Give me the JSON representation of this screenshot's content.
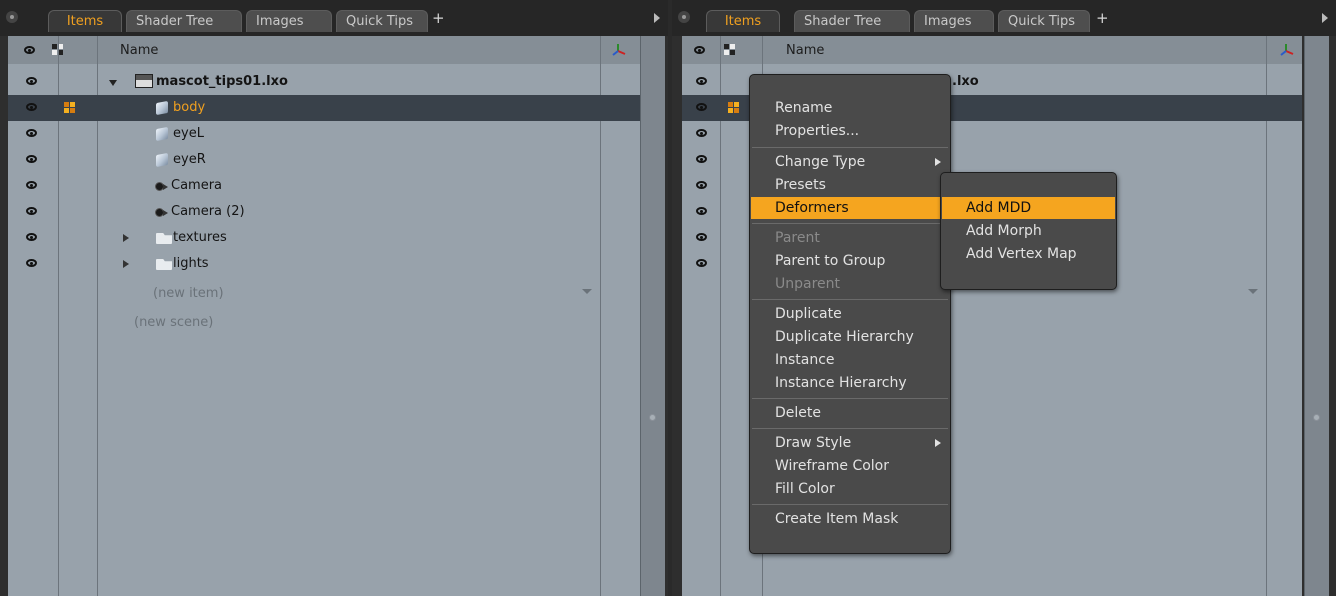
{
  "colors": {
    "accent": "#f0a020",
    "highlight": "#f5a51f",
    "list_bg": "#98a2ab",
    "selected_row": "#39414a",
    "menu_bg": "#4a4a4a"
  },
  "left_panel": {
    "tabs": [
      "Items",
      "Shader Tree",
      "Images",
      "Quick Tips"
    ],
    "add_tab": "+",
    "header_name": "Name",
    "scene_name": "mascot_tips01.lxo",
    "items": [
      {
        "label": "body",
        "icon": "mesh-icon",
        "selected": true
      },
      {
        "label": "eyeL",
        "icon": "mesh-icon"
      },
      {
        "label": "eyeR",
        "icon": "mesh-icon"
      },
      {
        "label": "Camera",
        "icon": "camera-icon"
      },
      {
        "label": "Camera (2)",
        "icon": "camera-icon"
      },
      {
        "label": "textures",
        "icon": "folder-icon",
        "collapsed": true
      },
      {
        "label": "lights",
        "icon": "folder-icon",
        "collapsed": true
      }
    ],
    "new_item": "(new item)",
    "new_scene": "(new scene)"
  },
  "right_panel": {
    "tabs": [
      "Items",
      "Shader Tree",
      "Images",
      "Quick Tips"
    ],
    "add_tab": "+",
    "header_name": "Name",
    "scene_name_visible": ".lxo"
  },
  "context_menu": {
    "groups": [
      [
        {
          "label": "Rename"
        },
        {
          "label": "Properties..."
        }
      ],
      [
        {
          "label": "Change Type",
          "submenu": true
        },
        {
          "label": "Presets"
        },
        {
          "label": "Deformers",
          "highlighted": true
        }
      ],
      [
        {
          "label": "Parent",
          "disabled": true
        },
        {
          "label": "Parent to Group"
        },
        {
          "label": "Unparent",
          "disabled": true
        }
      ],
      [
        {
          "label": "Duplicate"
        },
        {
          "label": "Duplicate Hierarchy"
        },
        {
          "label": "Instance"
        },
        {
          "label": "Instance Hierarchy"
        }
      ],
      [
        {
          "label": "Delete"
        }
      ],
      [
        {
          "label": "Draw Style",
          "submenu": true
        },
        {
          "label": "Wireframe Color"
        },
        {
          "label": "Fill Color"
        }
      ],
      [
        {
          "label": "Create Item Mask"
        }
      ]
    ]
  },
  "submenu": {
    "items": [
      {
        "label": "Add MDD",
        "highlighted": true
      },
      {
        "label": "Add Morph"
      },
      {
        "label": "Add Vertex Map"
      }
    ]
  }
}
